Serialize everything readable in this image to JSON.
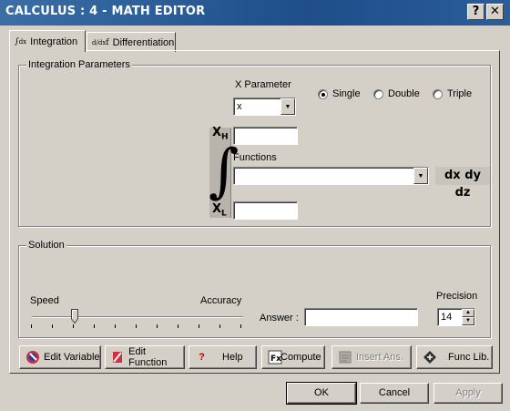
{
  "window": {
    "title": "CALCULUS : 4 - MATH EDITOR",
    "help_btn": "?",
    "close_btn": "✕"
  },
  "tabs": [
    {
      "label": "Integration",
      "icon": "integral-dx-icon"
    },
    {
      "label": "Differentiation",
      "icon": "derivative-icon"
    }
  ],
  "integration_params": {
    "group_label": "Integration Parameters",
    "x_parameter_label": "X Parameter",
    "x_parameter_value": "x",
    "modes": [
      {
        "label": "Single",
        "selected": true
      },
      {
        "label": "Double",
        "selected": false
      },
      {
        "label": "Triple",
        "selected": false
      }
    ],
    "upper_limit_symbol": "X",
    "upper_limit_sub": "H",
    "lower_limit_symbol": "X",
    "lower_limit_sub": "L",
    "integral_symbol": "∫",
    "upper_limit_value": "",
    "lower_limit_value": "",
    "functions_label": "Functions",
    "functions_value": "",
    "differentials": "dx dy dz"
  },
  "solution": {
    "group_label": "Solution",
    "speed_label": "Speed",
    "accuracy_label": "Accuracy",
    "answer_label": "Answer :",
    "answer_value": "",
    "precision_label": "Precision",
    "precision_value": "14"
  },
  "toolbar": [
    {
      "label": "Edit Variable",
      "icon": "edit-variable-icon",
      "enabled": true
    },
    {
      "label": "Edit Function",
      "icon": "edit-function-icon",
      "enabled": true
    },
    {
      "label": "Help",
      "icon": "help-icon",
      "enabled": true
    },
    {
      "label": "Compute",
      "icon": "compute-icon",
      "enabled": true
    },
    {
      "label": "Insert Ans.",
      "icon": "insert-answer-icon",
      "enabled": false
    },
    {
      "label": "Func Lib.",
      "icon": "function-library-icon",
      "enabled": true
    }
  ],
  "dialog": {
    "ok": "OK",
    "cancel": "Cancel",
    "apply": "Apply"
  },
  "colors": {
    "titlebar": "#1f4e8a",
    "face": "#d4d0c8"
  }
}
